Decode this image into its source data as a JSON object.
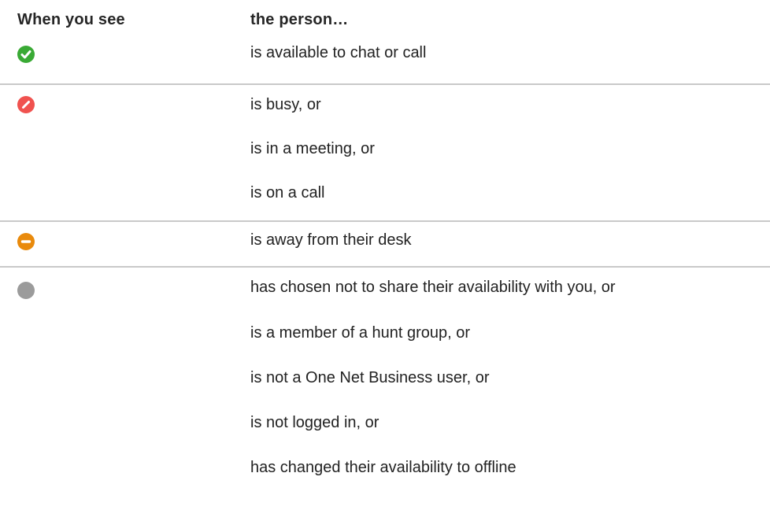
{
  "header": {
    "left": "When you see",
    "right": "the person…"
  },
  "rows": [
    {
      "icon": "available-check-icon",
      "color": "#3aaa35",
      "lines": [
        "is available to chat or call"
      ]
    },
    {
      "icon": "busy-icon",
      "color": "#f0524f",
      "lines": [
        "is busy, or",
        "is in a meeting, or",
        "is on a call"
      ]
    },
    {
      "icon": "away-icon",
      "color": "#e98a0c",
      "lines": [
        "is away from their desk"
      ]
    },
    {
      "icon": "offline-icon",
      "color": "#9b9b9b",
      "lines": [
        "has chosen not to share their availability with you, or",
        "is a member of a hunt group, or",
        "is not a One Net Business user, or",
        "is not logged in, or",
        "has changed their availability to offline"
      ]
    }
  ]
}
